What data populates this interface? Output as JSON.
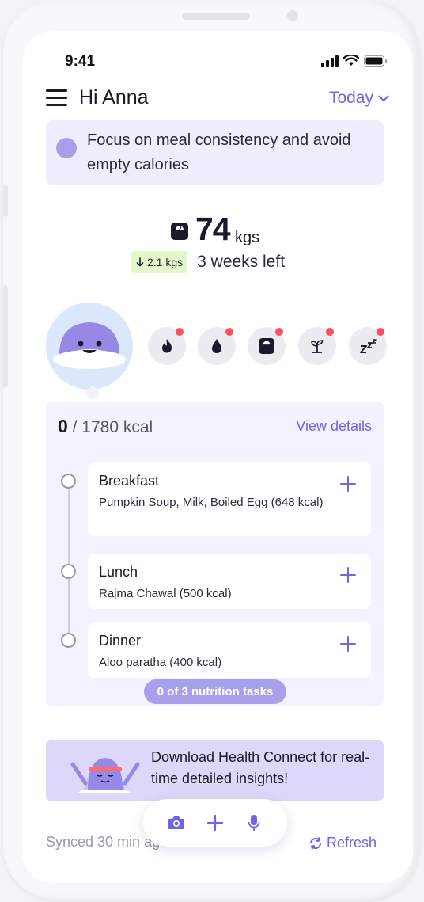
{
  "status_bar": {
    "time": "9:41"
  },
  "header": {
    "greeting": "Hi Anna",
    "date_filter": "Today"
  },
  "tip": {
    "text": "Focus on meal consistency and avoid empty calories"
  },
  "weight": {
    "value": "74",
    "unit": "kgs",
    "change": "2.1 kgs",
    "time_left": "3 weeks left"
  },
  "metrics": [
    {
      "icon": "flame-icon"
    },
    {
      "icon": "water-drop-icon"
    },
    {
      "icon": "weighing-scale-icon"
    },
    {
      "icon": "sprout-icon"
    },
    {
      "icon": "sleep-icon"
    }
  ],
  "calories": {
    "consumed": "0",
    "goal": "/ 1780 kcal",
    "view_details": "View details"
  },
  "meals": [
    {
      "title": "Breakfast",
      "desc": "Pumpkin Soup, Milk, Boiled Egg (648 kcal)"
    },
    {
      "title": "Lunch",
      "desc": "Rajma Chawal (500 kcal)"
    },
    {
      "title": "Dinner",
      "desc": "Aloo paratha (400 kcal)"
    }
  ],
  "tasks": {
    "label": "0 of 3 nutrition tasks"
  },
  "banner": {
    "text": "Download Health Connect for real-time detailed insights!"
  },
  "footer": {
    "synced": "Synced 30 min ago",
    "refresh": "Refresh"
  },
  "colors": {
    "accent": "#6f63e6",
    "card_bg": "#f4f2fe",
    "alert_dot": "#ff4d5e",
    "weight_badge": "#e4f7c9"
  }
}
